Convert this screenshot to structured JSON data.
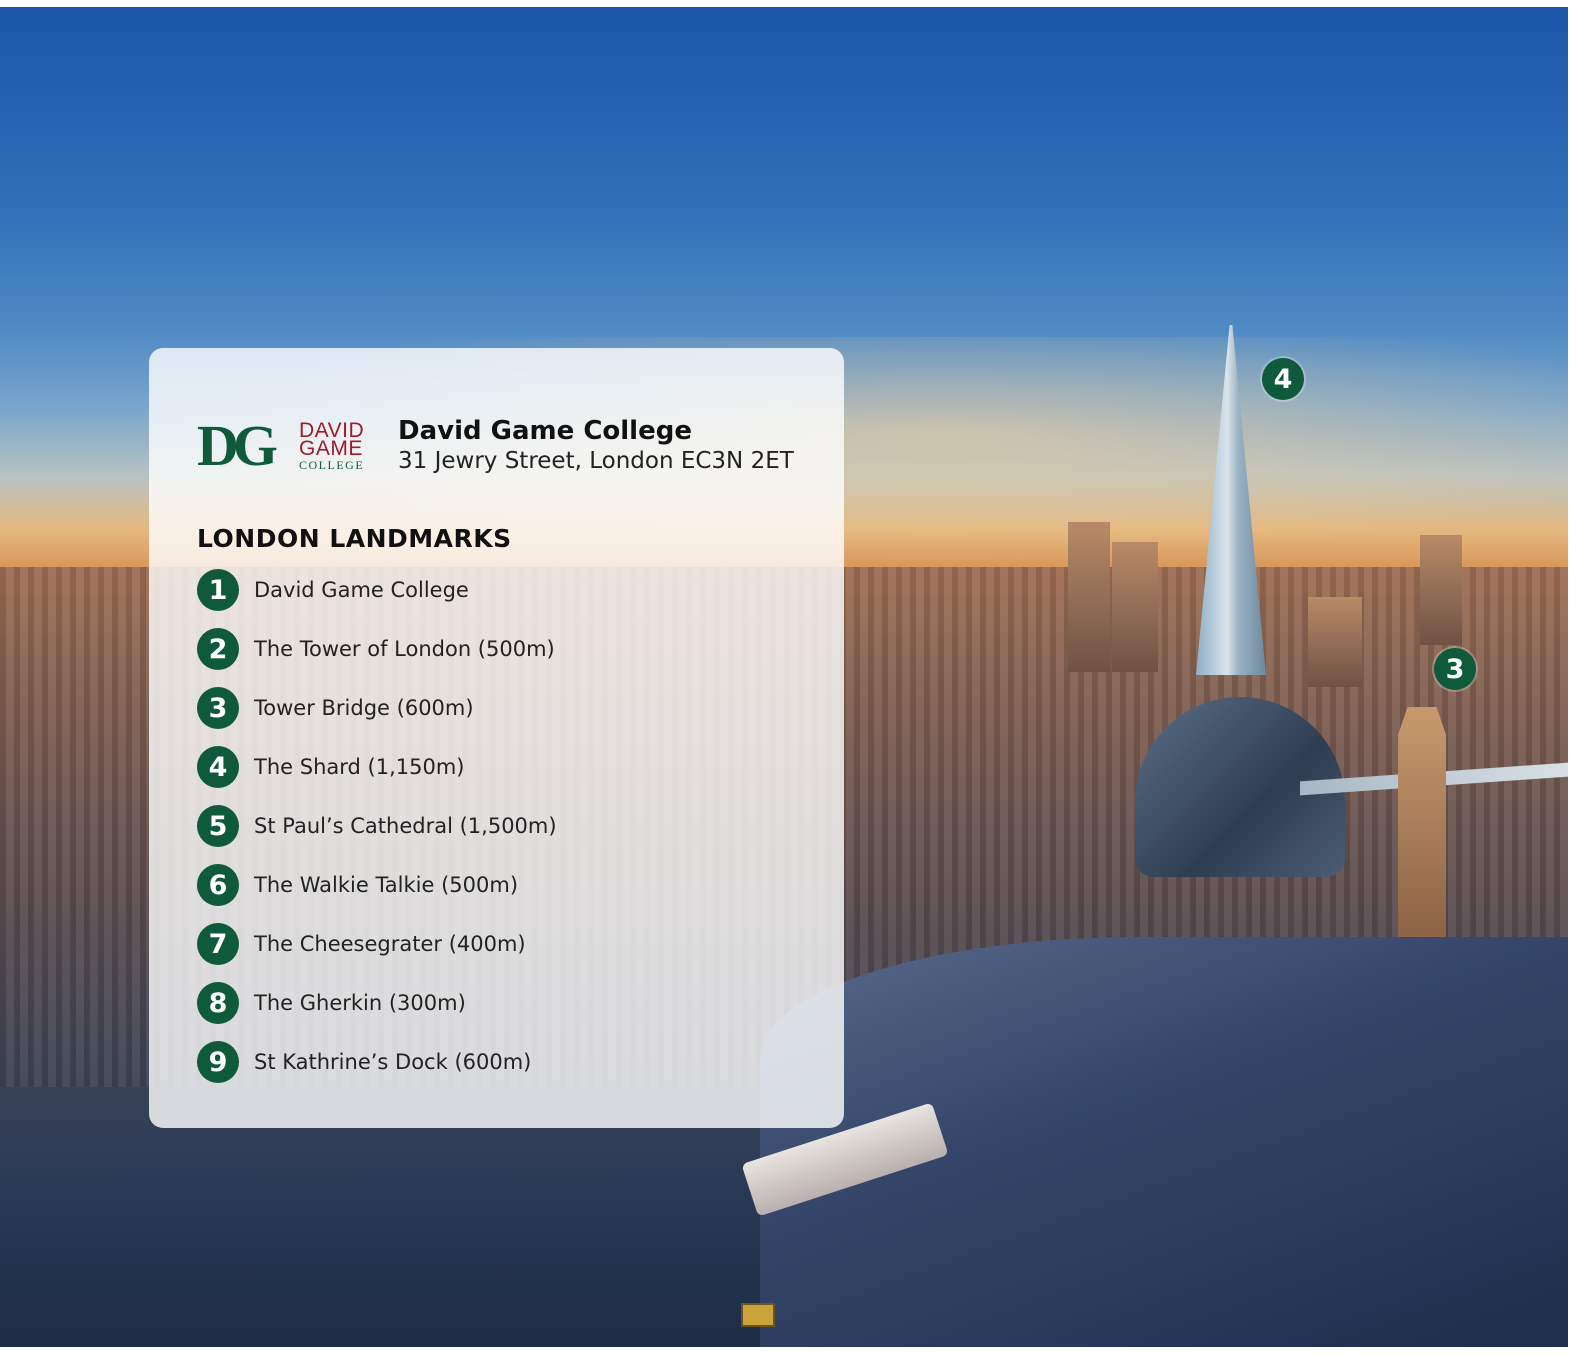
{
  "college": {
    "logo_monogram": "DG",
    "logo_line1": "DAVID",
    "logo_line2": "GAME",
    "logo_line3": "COLLEGE",
    "name": "David Game College",
    "address": "31 Jewry Street, London EC3N 2ET"
  },
  "landmarks": {
    "heading": "LONDON LANDMARKS",
    "items": [
      {
        "number": "1",
        "label": "David Game College"
      },
      {
        "number": "2",
        "label": "The Tower of London (500m)"
      },
      {
        "number": "3",
        "label": "Tower Bridge (600m)"
      },
      {
        "number": "4",
        "label": "The Shard (1,150m)"
      },
      {
        "number": "5",
        "label": "St Paul’s Cathedral (1,500m)"
      },
      {
        "number": "6",
        "label": "The Walkie Talkie (500m)"
      },
      {
        "number": "7",
        "label": "The Cheesegrater (400m)"
      },
      {
        "number": "8",
        "label": "The Gherkin (300m)"
      },
      {
        "number": "9",
        "label": "St Kathrine’s Dock (600m)"
      }
    ]
  },
  "photo_markers": [
    {
      "number": "4"
    },
    {
      "number": "3"
    }
  ],
  "colors": {
    "marker_green": "#0e5a3a",
    "logo_red": "#9b1c2c"
  }
}
